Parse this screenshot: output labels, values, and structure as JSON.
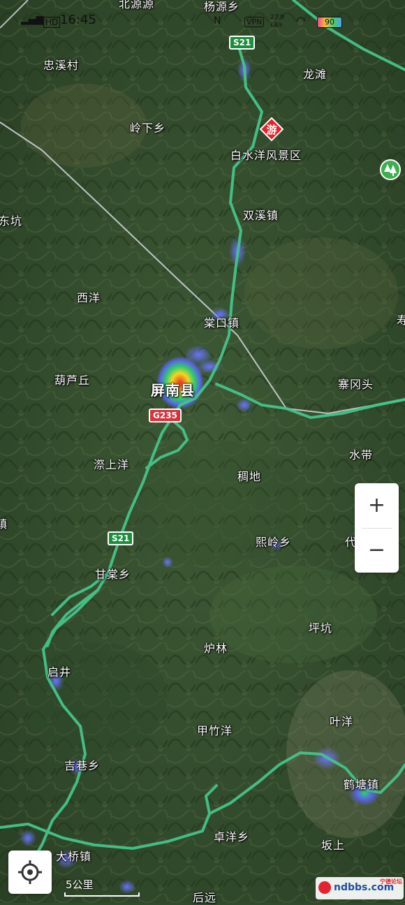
{
  "status_bar": {
    "time": "16:45",
    "net_speed": "27.8",
    "net_unit": "KB/s",
    "battery": "90",
    "vpn": "VPN"
  },
  "roads": {
    "s21_top": "S21",
    "s21_mid": "S21",
    "g235": "G235"
  },
  "places": {
    "p_beiyuan": "北源源",
    "p_yangyuan": "杨源乡",
    "p_zhongxicun": "忠溪村",
    "p_longtan": "龙滩",
    "p_lingxia": "岭下乡",
    "p_baishuiyang": "白水洋风景区",
    "p_dongkeng": "东坑",
    "p_shuangxi": "双溪镇",
    "p_xiyang": "西洋",
    "p_tangkou": "棠口镇",
    "p_shou": "寿",
    "p_hulu": "葫芦丘",
    "p_pingnan": "屏南县",
    "p_saigangtou": "寨冈头",
    "p_shuidai": "水带",
    "p_jiangshangyang": "漈上洋",
    "p_qidi": "稠地",
    "p_zhen": "镇",
    "p_xiling": "熙岭乡",
    "p_dai": "代",
    "p_gantang": "甘棠乡",
    "p_pingkeng": "坪坑",
    "p_lulin": "炉林",
    "p_qijing": "启井",
    "p_yeyang": "叶洋",
    "p_jiazhuyang": "甲竹洋",
    "p_jixiang": "吉巷乡",
    "p_hetang": "鹤塘镇",
    "p_zhuoyang": "卓洋乡",
    "p_dalian": "大桥镇",
    "p_banshang": "坂上",
    "p_houyuan": "后远"
  },
  "controls": {
    "zoom_in": "+",
    "zoom_out": "−",
    "scale": "5公里"
  },
  "watermark": {
    "text": "ndbbs.com",
    "sub": "宁德论坛"
  },
  "icons": {
    "scenic": "scenic-spot-icon",
    "park": "park-tree-icon",
    "locate": "locate-icon"
  },
  "colors": {
    "road_green": "#45c48a",
    "heat_red": "#e83323",
    "shield_green": "#1a8f3c",
    "shield_red": "#d8333c"
  }
}
